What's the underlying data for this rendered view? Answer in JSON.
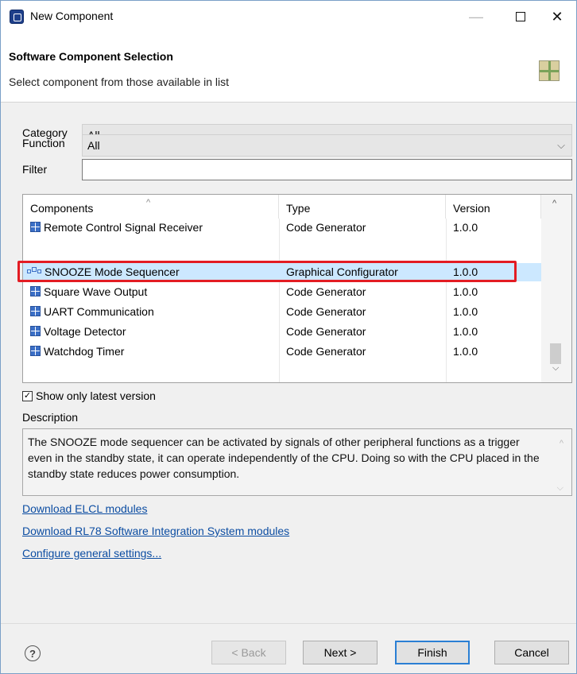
{
  "window": {
    "title": "New Component"
  },
  "header": {
    "title": "Software Component Selection",
    "subtitle": "Select component from those available in list"
  },
  "filters": {
    "category_label": "Category",
    "category_value": "All",
    "function_label": "Function",
    "function_value": "All",
    "filter_label": "Filter",
    "filter_value": ""
  },
  "table": {
    "columns": [
      "Components",
      "Type",
      "Version"
    ],
    "rows": [
      {
        "name": "Remote Control Signal Receiver",
        "type": "Code Generator",
        "version": "1.0.0",
        "icon": "component-icon"
      },
      {
        "name": "SNOOZE Mode Sequencer",
        "type": "Graphical Configurator",
        "version": "1.0.0",
        "icon": "graphical-config-icon",
        "selected": true
      },
      {
        "name": "Square Wave Output",
        "type": "Code Generator",
        "version": "1.0.0",
        "icon": "component-icon"
      },
      {
        "name": "UART Communication",
        "type": "Code Generator",
        "version": "1.0.0",
        "icon": "component-icon"
      },
      {
        "name": "Voltage Detector",
        "type": "Code Generator",
        "version": "1.0.0",
        "icon": "component-icon"
      },
      {
        "name": "Watchdog Timer",
        "type": "Code Generator",
        "version": "1.0.0",
        "icon": "component-icon"
      }
    ]
  },
  "options": {
    "show_latest_label": "Show only latest version",
    "show_latest_checked": true
  },
  "description": {
    "label": "Description",
    "text": "The SNOOZE mode sequencer can be activated by signals of other peripheral functions as a trigger even in the standby state, it can operate independently of the CPU. Doing so with the CPU placed in the standby state reduces power consumption."
  },
  "links": {
    "download_elcl": "Download ELCL modules",
    "download_rl78": "Download RL78 Software Integration System modules",
    "configure": "Configure general settings..."
  },
  "buttons": {
    "back": "< Back",
    "next": "Next >",
    "finish": "Finish",
    "cancel": "Cancel"
  },
  "colors": {
    "highlight_border": "#e31c23",
    "selected_row": "#cce8ff",
    "link": "#0c4da2"
  }
}
